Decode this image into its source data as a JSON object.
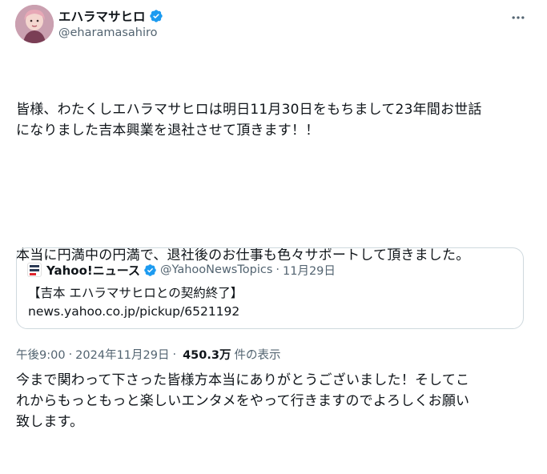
{
  "author": {
    "display_name": "エハラマサヒロ",
    "handle": "@eharamasahiro",
    "avatar_icon": "avatar-photo",
    "verified_icon": "verified-badge-icon",
    "verified_color": "#1d9bf0"
  },
  "more_icon": "more-horizontal-icon",
  "body": {
    "paragraphs": [
      "皆様、わたくしエハラマサヒロは明日11月30日をもちまして23年間お世話\nになりました吉本興業を退社させて頂きます！！",
      "本当に円満中の円満で、退社後のお仕事も色々サポートして頂きました。",
      "今まで関わって下さった皆様方本当にありがとうございました！そしてこ\nれからもっともっと楽しいエンタメをやって行きますのでよろしくお願い\n致します。"
    ]
  },
  "quote": {
    "logo_icon": "yahoo-news-logo-icon",
    "name": "Yahoo!ニュース",
    "handle": "@YahooNewsTopics",
    "dot": "·",
    "date": "11月29日",
    "text": "【吉本 エハラマサヒロとの契約終了】",
    "link": "news.yahoo.co.jp/pickup/6521192"
  },
  "meta": {
    "time": "午後9:00",
    "sep": "·",
    "date": "2024年11月29日",
    "sep2": "·",
    "views_count": "450.3万",
    "views_label": "件の表示"
  },
  "colors": {
    "text_primary": "#0f1419",
    "text_secondary": "#536471",
    "border": "#cfd9de",
    "verified": "#1d9bf0"
  }
}
